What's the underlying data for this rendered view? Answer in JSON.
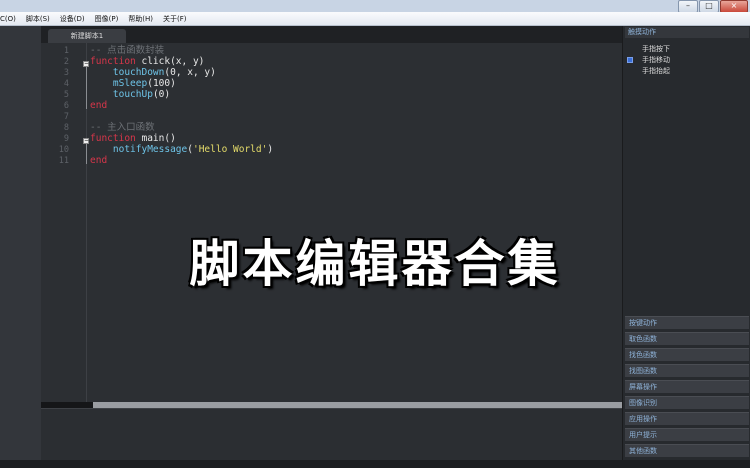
{
  "menu": [
    "C(O)",
    "脚本(S)",
    "设备(D)",
    "图像(P)",
    "帮助(H)",
    "关于(F)"
  ],
  "window_buttons": [
    "–",
    "□",
    "×"
  ],
  "tab": {
    "label": "新建脚本1"
  },
  "code": {
    "line_numbers": [
      "1",
      "2",
      "3",
      "4",
      "5",
      "6",
      "7",
      "8",
      "9",
      "10",
      "11"
    ],
    "l1": "-- 点击函数封装",
    "l2_kw": "function",
    "l2_rest": " click(x, y)",
    "l3_fn": "touchDown",
    "l3_rest": "(0, x, y)",
    "l4_fn": "mSleep",
    "l4_rest": "(100)",
    "l5_fn": "touchUp",
    "l5_rest": "(0)",
    "l6_kw": "end",
    "l8": "-- 主入口函数",
    "l9_kw": "function",
    "l9_rest": " main()",
    "l10_fn": "notifyMessage",
    "l10_open": "(",
    "l10_str": "'Hello World'",
    "l10_close": ")",
    "l11_kw": "end"
  },
  "right_panel": {
    "header": "触摸动作",
    "items": [
      "手指按下",
      "手指移动",
      "手指抬起"
    ],
    "categories": [
      "按键动作",
      "取色函数",
      "找色函数",
      "找图函数",
      "屏幕操作",
      "图像识别",
      "应用操作",
      "用户提示",
      "其他函数"
    ]
  },
  "overlay_title": "脚本编辑器合集",
  "colors": {
    "keyword": "#d6364a",
    "call": "#6ec4e8",
    "string": "#e5dc6a",
    "comment": "#6d7176",
    "selected": "#3a6fd8"
  }
}
